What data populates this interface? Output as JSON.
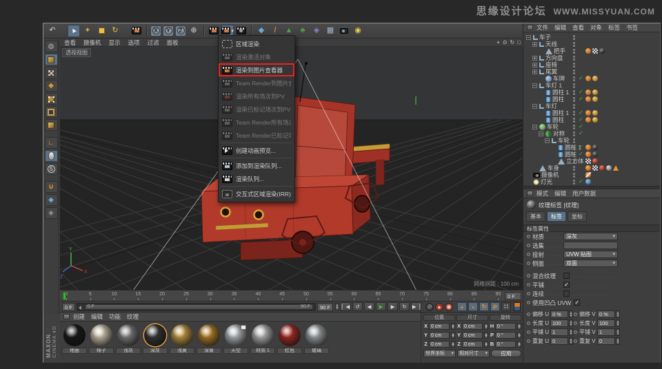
{
  "watermark": {
    "site": "思缘设计论坛",
    "url": "WWW.MISSYUAN.COM"
  },
  "brand": {
    "line1": "MAXON",
    "line2": "CINEMA 4D"
  },
  "colors": {
    "highlight_red": "#ee2222",
    "accent_blue": "#5b7287",
    "accent_orange": "#e8922a",
    "play_green": "#3fbf3f"
  },
  "toolbar": {
    "items": [
      {
        "name": "undo-button",
        "kind": "glyph",
        "glyph": "↶",
        "color": "#d0d0d0"
      },
      {
        "kind": "gap"
      },
      {
        "name": "live-selection-tool",
        "kind": "cursor",
        "active": true
      },
      {
        "name": "move-tool",
        "kind": "glyph",
        "glyph": "+",
        "color": "#e8c24a",
        "bold": true
      },
      {
        "name": "scale-tool",
        "kind": "scale"
      },
      {
        "name": "rotate-tool",
        "kind": "glyph",
        "glyph": "↻",
        "color": "#e8c24a"
      },
      {
        "kind": "gap"
      },
      {
        "name": "last-tool-used-button",
        "kind": "clapper"
      },
      {
        "kind": "sep"
      },
      {
        "name": "lock-x-button",
        "kind": "axis",
        "label": "X"
      },
      {
        "name": "lock-y-button",
        "kind": "axis",
        "label": "Y"
      },
      {
        "name": "lock-z-button",
        "kind": "axis",
        "label": "Z"
      },
      {
        "name": "coordinate-system-button",
        "kind": "glyph",
        "glyph": "⊕",
        "color": "#cfcfcf"
      },
      {
        "kind": "sep"
      },
      {
        "name": "render-view-button",
        "kind": "clapper"
      },
      {
        "name": "render-menu-button",
        "kind": "clapper",
        "active": true,
        "arrow": true
      },
      {
        "name": "render-settings-button",
        "kind": "clapper",
        "gear": true
      },
      {
        "kind": "sep"
      },
      {
        "name": "subdivision-surface-button",
        "kind": "glyph",
        "glyph": "◆",
        "color": "#6fa8d8"
      },
      {
        "name": "spline-pen-button",
        "kind": "glyph",
        "glyph": "/",
        "color": "#d8803a",
        "bold": true
      },
      {
        "name": "landscape-object-button",
        "kind": "glyph",
        "glyph": "▲",
        "color": "#4f9f4f"
      },
      {
        "name": "tree-object-button",
        "kind": "glyph",
        "glyph": "♣",
        "color": "#4f9f4f"
      },
      {
        "name": "deformer-object-button",
        "kind": "glyph",
        "glyph": "◈",
        "color": "#8f7fd8"
      },
      {
        "name": "floor-object-button",
        "kind": "glyph",
        "glyph": "▦",
        "color": "#9fb3c8"
      },
      {
        "name": "camera-object-button",
        "kind": "cam"
      },
      {
        "name": "light-object-button",
        "kind": "glyph",
        "glyph": "◉",
        "color": "#e8d24a"
      }
    ]
  },
  "left_toolbar": {
    "items": [
      {
        "name": "make-editable-button",
        "kind": "glyph",
        "glyph": "◍",
        "color": "#b5b5b5"
      },
      {
        "name": "model-mode-button",
        "kind": "cube",
        "variant": "solid",
        "active": true
      },
      {
        "name": "texture-mode-button",
        "kind": "cube",
        "variant": "checker"
      },
      {
        "name": "workplane-mode-button",
        "kind": "glyph",
        "glyph": "◆",
        "color": "#d8983a"
      },
      {
        "name": "points-mode-button",
        "kind": "cube",
        "variant": "points"
      },
      {
        "name": "edges-mode-button",
        "kind": "cube",
        "variant": "edges"
      },
      {
        "name": "polygons-mode-button",
        "kind": "cube",
        "variant": "polys"
      },
      {
        "kind": "gap"
      },
      {
        "name": "enable-axis-button",
        "kind": "glyph",
        "glyph": "∟",
        "color": "#e8932a",
        "bold": true
      },
      {
        "name": "viewport-solo-button",
        "kind": "mouse",
        "active": true
      },
      {
        "name": "snap-button",
        "kind": "glyph",
        "glyph": "S",
        "color": "#e6e6e6",
        "circle": true
      },
      {
        "kind": "gap"
      },
      {
        "name": "magnet-button",
        "kind": "glyph",
        "glyph": "∪",
        "color": "#e8932a",
        "bold": true
      },
      {
        "name": "layer-browser-button",
        "kind": "glyph",
        "glyph": "◆",
        "color": "#6fa8d8"
      },
      {
        "name": "lock-workplane-button",
        "kind": "glyph",
        "glyph": "◈",
        "color": "#9a9a9a"
      }
    ]
  },
  "viewport": {
    "menu": [
      "查看",
      "摄像机",
      "显示",
      "选项",
      "过滤",
      "面板"
    ],
    "view_label": "透视视图",
    "grid_label": "网格间距 : 100 cm",
    "nav": [
      {
        "name": "pan-view-icon",
        "glyph": "+"
      },
      {
        "name": "zoom-view-icon",
        "glyph": "⊙"
      },
      {
        "name": "rotate-view-icon",
        "glyph": "↻"
      },
      {
        "name": "maximize-view-icon",
        "glyph": "□"
      }
    ],
    "axis_labels": {
      "x": "X",
      "y": "Y",
      "z": "Z"
    }
  },
  "render_menu": {
    "items": [
      {
        "label": "区域渲染",
        "icon": "region",
        "enabled": true
      },
      {
        "label": "渲染激活对象",
        "icon": "clapper",
        "enabled": false
      },
      {
        "label": "渲染到图片查看器",
        "icon": "clapper-pv",
        "enabled": true,
        "highlighted": true
      },
      {
        "label": "Team Render到图片查看器...",
        "icon": "team",
        "enabled": false
      },
      {
        "label": "渲染所有场次到PV",
        "icon": "clapper-red",
        "enabled": false
      },
      {
        "label": "渲染已标记场次到PV",
        "icon": "team",
        "enabled": false
      },
      {
        "label": "Team Render所有场次到PV",
        "icon": "team",
        "enabled": false
      },
      {
        "label": "Team Render已标记场次到PV",
        "icon": "team",
        "enabled": false,
        "sep_after": true
      },
      {
        "label": "创建动画预览...",
        "icon": "preview",
        "enabled": true,
        "sep_after": true
      },
      {
        "label": "添加到渲染队列...",
        "icon": "queue-add",
        "enabled": true
      },
      {
        "label": "渲染队列...",
        "icon": "queue",
        "enabled": true,
        "sep_after": true
      },
      {
        "label": "交互式区域渲染(IRR)",
        "icon": "irr",
        "enabled": true
      }
    ]
  },
  "object_manager": {
    "menu": [
      "文件",
      "编辑",
      "查看",
      "对象",
      "标签",
      "书签"
    ],
    "objects": [
      {
        "name": "车子",
        "level": 0,
        "exp": "−",
        "icon": "null"
      },
      {
        "name": "天线",
        "level": 1,
        "exp": "+",
        "icon": "null"
      },
      {
        "name": "把手",
        "level": 2,
        "icon": "mesh",
        "tags": [
          "orange",
          "checker",
          "dark"
        ]
      },
      {
        "name": "方向盘",
        "level": 1,
        "exp": "+",
        "icon": "null"
      },
      {
        "name": "座椅",
        "level": 1,
        "exp": "+",
        "icon": "null"
      },
      {
        "name": "尾翼",
        "level": 1,
        "exp": "+",
        "icon": "null"
      },
      {
        "name": "车牌",
        "level": 2,
        "icon": "sphere-blue",
        "check": true,
        "tags": [
          "orange",
          "gold"
        ]
      },
      {
        "name": "车灯 1",
        "level": 1,
        "exp": "−",
        "icon": "null"
      },
      {
        "name": "圆柱 1",
        "level": 2,
        "icon": "cyl",
        "check": true,
        "tags": [
          "orange",
          "gold"
        ]
      },
      {
        "name": "圆柱",
        "level": 2,
        "icon": "cyl",
        "check": true,
        "tags": [
          "orange",
          "gold"
        ]
      },
      {
        "name": "车灯",
        "level": 1,
        "exp": "−",
        "icon": "null"
      },
      {
        "name": "圆柱 1",
        "level": 2,
        "icon": "cyl",
        "check": true,
        "tags": [
          "orange",
          "gold"
        ]
      },
      {
        "name": "圆柱",
        "level": 2,
        "icon": "cyl",
        "check": true,
        "tags": [
          "orange",
          "gold"
        ]
      },
      {
        "name": "车轮",
        "level": 1,
        "exp": "−",
        "icon": "sphere-green",
        "check": true
      },
      {
        "name": "对称",
        "level": 2,
        "exp": "−",
        "icon": "sym",
        "check": true
      },
      {
        "name": "车轮",
        "level": 3,
        "exp": "−",
        "icon": "null"
      },
      {
        "name": "圆柱 1",
        "level": 4,
        "icon": "cyl",
        "check": true,
        "tags": [
          "orange",
          "dark"
        ]
      },
      {
        "name": "圆柱",
        "level": 4,
        "icon": "cyl",
        "check": true,
        "tags": [
          "orange",
          "dark"
        ]
      },
      {
        "name": "立方体 1",
        "level": 4,
        "icon": "mesh",
        "tags": [
          "checker",
          "red"
        ]
      },
      {
        "name": "车身",
        "level": 1,
        "icon": "mesh",
        "tags": [
          "orange",
          "checker",
          "red",
          "gray",
          "tri"
        ]
      },
      {
        "name": "摄像机",
        "level": 0,
        "icon": "cam",
        "tags": [
          "camslash"
        ]
      },
      {
        "name": "灯光",
        "level": 0,
        "icon": "light",
        "check": true,
        "tags": [
          "blue"
        ]
      }
    ]
  },
  "attributes": {
    "menu": [
      "模式",
      "编辑",
      "用户数据"
    ],
    "title": "纹理标签 [纹理]",
    "tabs": [
      "基本",
      "标签",
      "坐标"
    ],
    "active_tab": "标签",
    "section": "标签属性",
    "fields": [
      {
        "label": "材质",
        "type": "link",
        "value": "深灰"
      },
      {
        "label": "选集",
        "type": "text",
        "value": ""
      },
      {
        "label": "投射",
        "type": "dropdown",
        "value": "UVW 贴图"
      },
      {
        "label": "侧面",
        "type": "dropdown",
        "value": "双面"
      },
      {
        "label": "混合纹理",
        "type": "check",
        "checked": false,
        "gap_before": true
      },
      {
        "label": "平铺",
        "type": "check",
        "checked": true
      },
      {
        "label": "连续",
        "type": "check",
        "checked": false
      },
      {
        "label": "使用凹凸 UVW",
        "type": "check",
        "checked": true,
        "inline": true
      }
    ],
    "uv_rows": [
      [
        {
          "label": "偏移 U",
          "value": "0 %"
        },
        {
          "label": "偏移 V",
          "value": "0 %"
        }
      ],
      [
        {
          "label": "长度 U",
          "value": "100 %"
        },
        {
          "label": "长度 V",
          "value": "100 %"
        }
      ],
      [
        {
          "label": "平铺 U",
          "value": "1"
        },
        {
          "label": "平铺 V",
          "value": "1"
        }
      ],
      [
        {
          "label": "重复 U",
          "value": "0"
        },
        {
          "label": "重复 V",
          "value": "0"
        }
      ]
    ]
  },
  "materials": {
    "menu": [
      "创建",
      "编辑",
      "功能",
      "纹理"
    ],
    "items": [
      {
        "name": "地面",
        "color": "#1b1b1b"
      },
      {
        "name": "椅子",
        "color": "#e8dfc4"
      },
      {
        "name": "浅灰",
        "color": "#8f8f8f"
      },
      {
        "name": "深灰",
        "color": "#3c3c3c",
        "selected": true
      },
      {
        "name": "浅黄",
        "color": "#dcae4e"
      },
      {
        "name": "深黄",
        "color": "#c98f2d"
      },
      {
        "name": "天空",
        "color": "#cdd3d8",
        "badge": true
      },
      {
        "name": "材质 1",
        "color": "#cfcfcf"
      },
      {
        "name": "红色",
        "color": "#bb3227"
      },
      {
        "name": "玻璃",
        "color": "#b5babd"
      }
    ]
  },
  "coordinates": {
    "groups": [
      {
        "header": "位置",
        "rows": [
          [
            "X",
            "0 cm"
          ],
          [
            "Y",
            "0 cm"
          ],
          [
            "Z",
            "0 cm"
          ]
        ]
      },
      {
        "header": "尺寸",
        "rows": [
          [
            "X",
            "0 cm"
          ],
          [
            "Y",
            "0 cm"
          ],
          [
            "Z",
            "0 cm"
          ]
        ]
      },
      {
        "header": "旋转",
        "rows": [
          [
            "H",
            "0 °"
          ],
          [
            "P",
            "0 °"
          ],
          [
            "B",
            "0 °"
          ]
        ]
      }
    ],
    "mode_left": "世界坐标",
    "mode_right": "相对尺寸",
    "apply_label": "应用"
  },
  "timeline": {
    "ticks": [
      "0",
      "5",
      "10",
      "15",
      "20",
      "25",
      "30",
      "35",
      "40",
      "45",
      "50",
      "55",
      "60",
      "65",
      "70",
      "75",
      "80",
      "85",
      "90"
    ],
    "current": "0 F",
    "range_start": "0 F",
    "range_end": "90 F",
    "end": "90 F",
    "transport": [
      {
        "name": "goto-start-button",
        "glyph": "▏◀"
      },
      {
        "name": "play-mode-button",
        "glyph": "↺"
      },
      {
        "name": "prev-frame-button",
        "glyph": "◀"
      },
      {
        "name": "play-button",
        "glyph": "▶",
        "color": "#3fbf3f"
      },
      {
        "name": "next-frame-button",
        "glyph": "▶"
      },
      {
        "name": "loop-button",
        "glyph": "↻"
      },
      {
        "name": "goto-end-button",
        "glyph": "▶▕"
      }
    ],
    "records": [
      {
        "name": "record-button",
        "glyph": "⊘",
        "color": "#b5b5b5",
        "bg": "#3a3a3a"
      },
      {
        "name": "autokey-button",
        "glyph": "●",
        "color": "#e8d0c0",
        "bg": "#a03428"
      },
      {
        "name": "keyframe-selection-button",
        "glyph": "◉",
        "color": "#e8d0c0",
        "bg": "#a03428"
      }
    ],
    "keys": [
      {
        "name": "key-position-button",
        "glyph": "+",
        "active": true
      },
      {
        "name": "key-scale-button",
        "glyph": "▪",
        "active": true
      },
      {
        "name": "key-rotation-button",
        "glyph": "↻",
        "active": true
      },
      {
        "name": "key-parameter-button",
        "glyph": "P",
        "active": true
      },
      {
        "name": "key-pla-button",
        "glyph": "∷",
        "active": false
      }
    ]
  }
}
